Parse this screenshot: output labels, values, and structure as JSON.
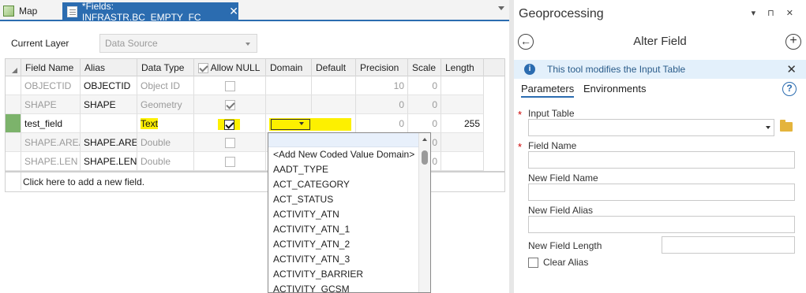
{
  "tabs": [
    {
      "label": "Map",
      "icon": "map-icon"
    },
    {
      "label": "*Fields:  INFRASTR.BC_EMPTY_FC",
      "icon": "fields-table-icon",
      "active": true
    }
  ],
  "current_layer": {
    "label": "Current Layer",
    "value": "Data Source"
  },
  "table": {
    "headers": [
      "Field Name",
      "Alias",
      "Data Type",
      "Allow NULL",
      "Domain",
      "Default",
      "Precision",
      "Scale",
      "Length"
    ],
    "rows": [
      {
        "field_name": "OBJECTID",
        "alias": "OBJECTID",
        "data_type": "Object ID",
        "allow_null": false,
        "domain": "",
        "default": "",
        "precision": "10",
        "scale": "0",
        "length": ""
      },
      {
        "field_name": "SHAPE",
        "alias": "SHAPE",
        "data_type": "Geometry",
        "allow_null": true,
        "domain": "",
        "default": "",
        "precision": "0",
        "scale": "0",
        "length": ""
      },
      {
        "field_name": "test_field",
        "alias": "",
        "data_type": "Text",
        "allow_null": true,
        "domain": "",
        "default": "",
        "precision": "0",
        "scale": "0",
        "length": "255"
      },
      {
        "field_name": "SHAPE.AREA",
        "alias": "SHAPE.AREA",
        "data_type": "Double",
        "allow_null": false,
        "domain": "",
        "default": "",
        "precision": "",
        "scale": "0",
        "length": ""
      },
      {
        "field_name": "SHAPE.LEN",
        "alias": "SHAPE.LEN",
        "data_type": "Double",
        "allow_null": false,
        "domain": "",
        "default": "",
        "precision": "",
        "scale": "0",
        "length": ""
      }
    ],
    "add_row_text": "Click here to add a new field."
  },
  "domain_dropdown": {
    "items": [
      "<Add New Coded Value Domain>",
      "AADT_TYPE",
      "ACT_CATEGORY",
      "ACT_STATUS",
      "ACTIVITY_ATN",
      "ACTIVITY_ATN_1",
      "ACTIVITY_ATN_2",
      "ACTIVITY_ATN_3",
      "ACTIVITY_BARRIER",
      "ACTIVITY_GCSM"
    ]
  },
  "geoprocessing": {
    "title": "Geoprocessing",
    "controls": "▾ ⊓ ✕",
    "tool_name": "Alter Field",
    "info": "This tool modifies the Input Table",
    "tabs": [
      "Parameters",
      "Environments"
    ],
    "fields": {
      "input_table": "Input Table",
      "field_name": "Field Name",
      "new_field_name": "New Field Name",
      "new_field_alias": "New Field Alias",
      "new_field_length": "New Field Length",
      "clear_alias": "Clear Alias"
    }
  },
  "colors": {
    "accent": "#2b6cb0",
    "highlight": "#fdf000",
    "row_selected": "#7cb36b"
  }
}
